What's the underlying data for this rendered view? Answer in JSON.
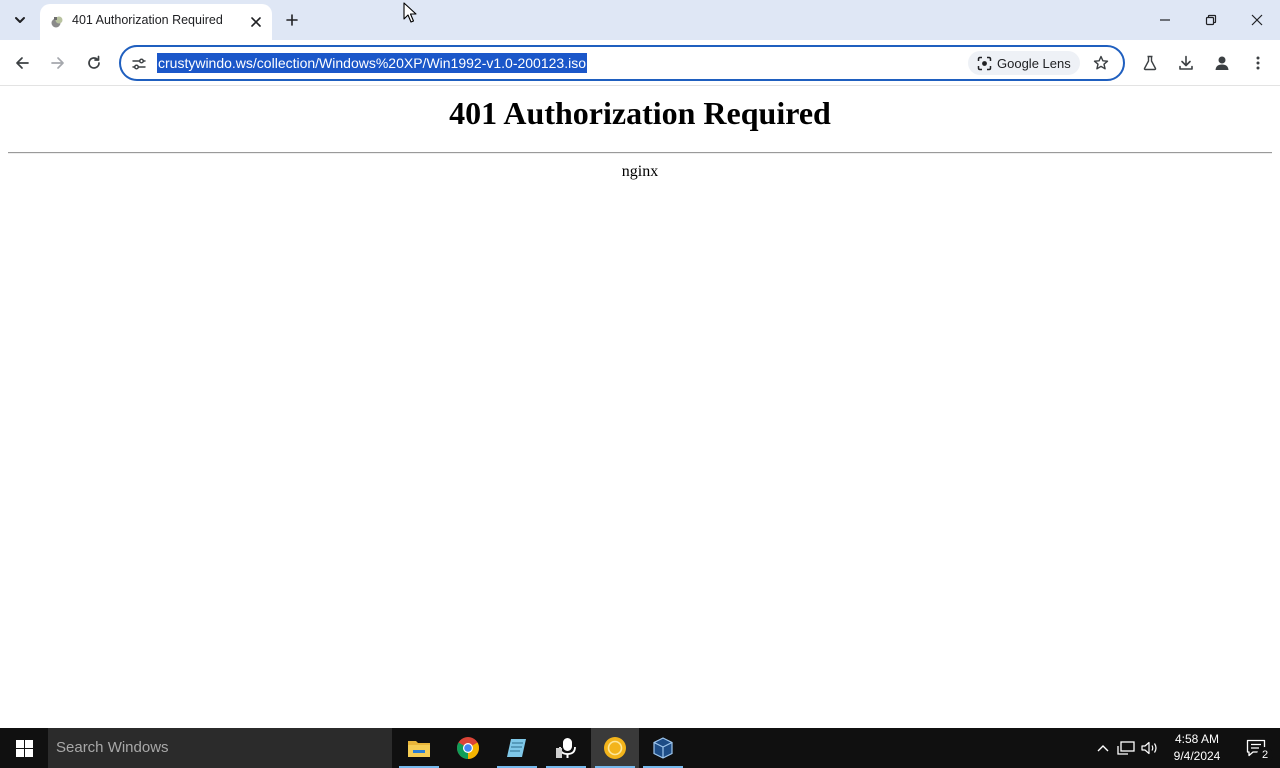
{
  "browser": {
    "tab": {
      "title": "401 Authorization Required",
      "favicon": "nginx-favicon-icon"
    },
    "new_tab_icon": "plus-icon",
    "window_controls": [
      "minimize-icon",
      "restore-icon",
      "close-icon"
    ],
    "toolbar": {
      "url": "crustywindo.ws/collection/Windows%20XP/Win1992-v1.0-200123.iso",
      "url_selected": true,
      "lens_label": "Google Lens",
      "icons": [
        "back-icon",
        "forward-icon",
        "reload-icon",
        "site-info-icon",
        "lens-icon",
        "star-icon",
        "labs-flask-icon",
        "download-icon",
        "profile-icon",
        "more-menu-icon"
      ]
    },
    "accent_color": "#1b57c9",
    "tabstrip_color": "#dfe7f5"
  },
  "page": {
    "heading": "401 Authorization Required",
    "server": "nginx"
  },
  "taskbar": {
    "search_placeholder": "Search Windows",
    "apps": [
      "file-explorer-icon",
      "chrome-icon",
      "notepad-icon",
      "voice-recorder-icon",
      "app-yellow-icon",
      "virtualbox-icon"
    ],
    "clock_time": "4:58 AM",
    "clock_date": "9/4/2024",
    "notification_count": "2"
  }
}
